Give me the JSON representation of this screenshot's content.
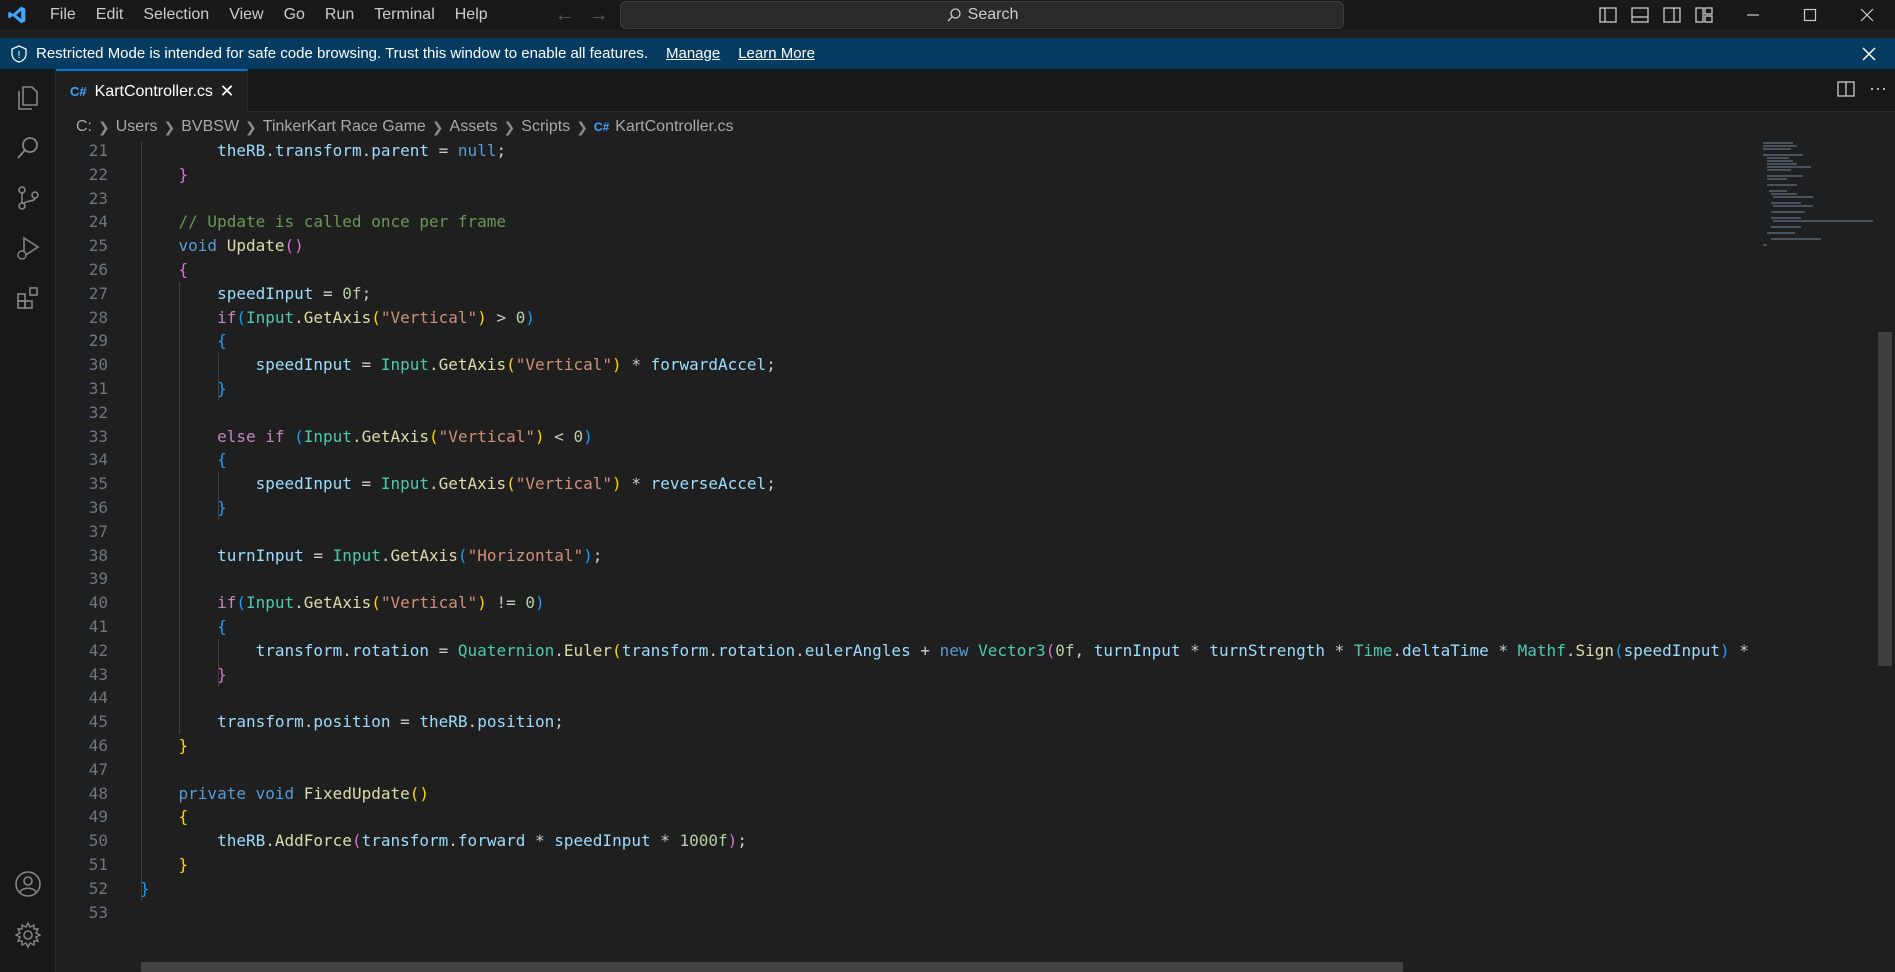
{
  "menu": [
    "File",
    "Edit",
    "Selection",
    "View",
    "Go",
    "Run",
    "Terminal",
    "Help"
  ],
  "search": {
    "label": "Search"
  },
  "banner": {
    "text": "Restricted Mode is intended for safe code browsing. Trust this window to enable all features.",
    "manage": "Manage",
    "learn_more": "Learn More"
  },
  "tab": {
    "label": "KartController.cs"
  },
  "breadcrumb": [
    "C:",
    "Users",
    "BVBSW",
    "TinkerKart Race Game",
    "Assets",
    "Scripts",
    "KartController.cs"
  ],
  "line_numbers": [
    "21",
    "22",
    "23",
    "24",
    "25",
    "26",
    "27",
    "28",
    "29",
    "30",
    "31",
    "32",
    "33",
    "34",
    "35",
    "36",
    "37",
    "38",
    "39",
    "40",
    "41",
    "42",
    "43",
    "44",
    "45",
    "46",
    "47",
    "48",
    "49",
    "50",
    "51",
    "52",
    "53"
  ],
  "code_lines": [
    "        theRB.transform.parent = null;",
    "    }",
    "",
    "    // Update is called once per frame",
    "    void Update()",
    "    {",
    "        speedInput = 0f;",
    "        if(Input.GetAxis(\"Vertical\") > 0)",
    "        {",
    "            speedInput = Input.GetAxis(\"Vertical\") * forwardAccel;",
    "        }",
    "",
    "        else if (Input.GetAxis(\"Vertical\") < 0)",
    "        {",
    "            speedInput = Input.GetAxis(\"Vertical\") * reverseAccel;",
    "        }",
    "",
    "        turnInput = Input.GetAxis(\"Horizontal\");",
    "",
    "        if(Input.GetAxis(\"Vertical\") != 0)",
    "        {",
    "            transform.rotation = Quaternion.Euler(transform.rotation.eulerAngles + new Vector3(0f, turnInput * turnStrength * Time.deltaTime * Mathf.Sign(speedInput) *",
    "        }",
    "",
    "        transform.position = theRB.position;",
    "    }",
    "",
    "    private void FixedUpdate()",
    "    {",
    "        theRB.AddForce(transform.forward * speedInput * 1000f);",
    "    }",
    "}",
    ""
  ]
}
